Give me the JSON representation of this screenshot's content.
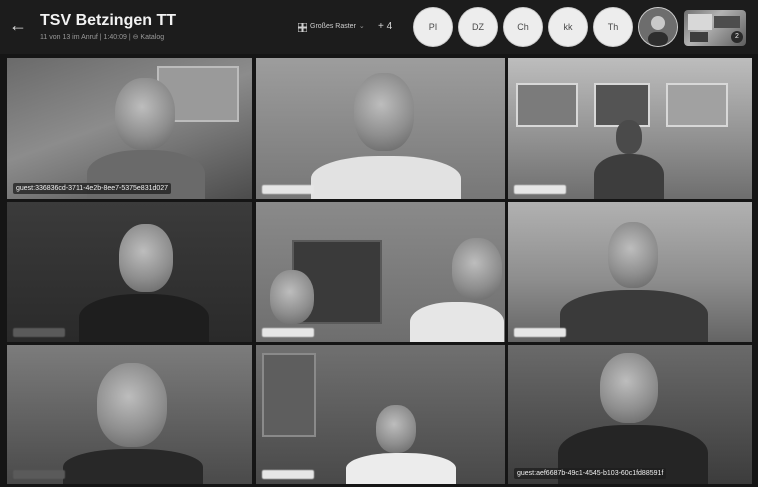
{
  "header": {
    "back_icon": "arrow-left-icon",
    "title": "TSV Betzingen TT",
    "subtitle": "11 von 13 im Anruf | 1:40:09 | ⊖ Katalog",
    "layout_label": "Großes Raster",
    "layout_icon": "grid-icon",
    "more_count": "+ 4"
  },
  "participants": [
    {
      "initials": "PI"
    },
    {
      "initials": "DZ"
    },
    {
      "initials": "Ch"
    },
    {
      "initials": "kk"
    },
    {
      "initials": "Th"
    }
  ],
  "avatar_photo": {
    "icon": "user-photo-icon"
  },
  "thumbnail": {
    "badge": "2",
    "icon": "thumbnail-preview-icon"
  },
  "tiles": [
    {
      "name": "guest:336836cd-3711-4e2b-8ee7-5375e831d027"
    },
    {
      "name": ""
    },
    {
      "name": ""
    },
    {
      "name": ""
    },
    {
      "name": ""
    },
    {
      "name": ""
    },
    {
      "name": ""
    },
    {
      "name": ""
    },
    {
      "name": "guest:aef6687b-49c1-4545-b103-60c1fd88591f"
    }
  ]
}
